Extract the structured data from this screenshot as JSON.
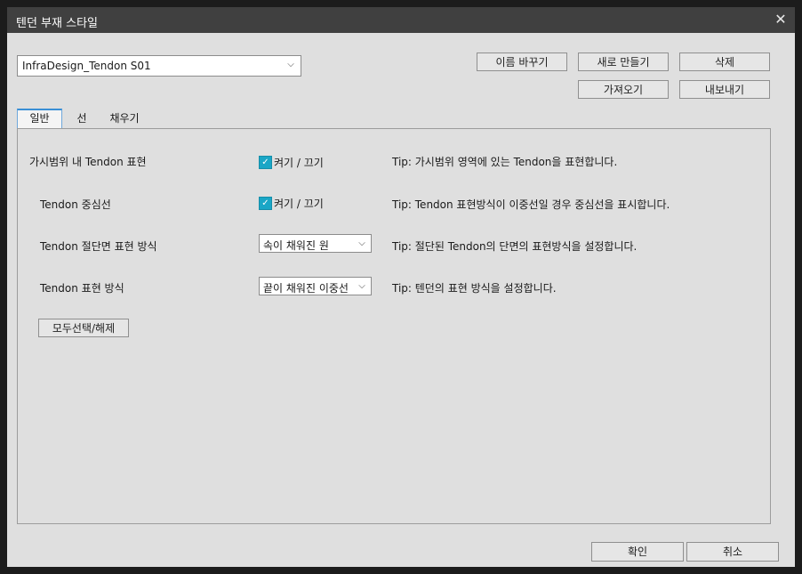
{
  "window": {
    "title": "텐던 부재 스타일",
    "close_glyph": "✕"
  },
  "style_select": {
    "value": "InfraDesign_Tendon S01",
    "chevron": "⌵"
  },
  "toolbar": {
    "rename": "이름 바꾸기",
    "new": "새로 만들기",
    "delete": "삭제",
    "import": "가져오기",
    "export": "내보내기"
  },
  "tabs": [
    {
      "label": "일반",
      "active": true
    },
    {
      "label": "선",
      "active": false
    },
    {
      "label": "채우기",
      "active": false
    }
  ],
  "rows": [
    {
      "label": "가시범위 내 Tendon 표현",
      "control": "checkbox",
      "checked": true,
      "control_label": "켜기 / 끄기",
      "tip": "Tip: 가시범위 영역에 있는 Tendon을 표현합니다."
    },
    {
      "label": "Tendon 중심선",
      "control": "checkbox",
      "checked": true,
      "control_label": "켜기 / 끄기",
      "tip": "Tip: Tendon 표현방식이 이중선일 경우 중심선을 표시합니다."
    },
    {
      "label": "Tendon 절단면 표현 방식",
      "control": "select",
      "value": "속이 채워진 원",
      "tip": "Tip: 절단된 Tendon의 단면의 표현방식을 설정합니다."
    },
    {
      "label": "Tendon 표현 방식",
      "control": "select",
      "value": "끝이 채워진 이중선",
      "tip": "Tip: 텐던의 표현 방식을 설정합니다."
    }
  ],
  "select_all": "모두선택/해제",
  "footer": {
    "ok": "확인",
    "cancel": "취소"
  },
  "icons": {
    "check": "✓",
    "chevron": "⌵"
  },
  "colors": {
    "titlebar": "#404040",
    "checkbox": "#1aa6c6",
    "tab_accent": "#3a8fd6",
    "body": "#dfdfdf"
  }
}
